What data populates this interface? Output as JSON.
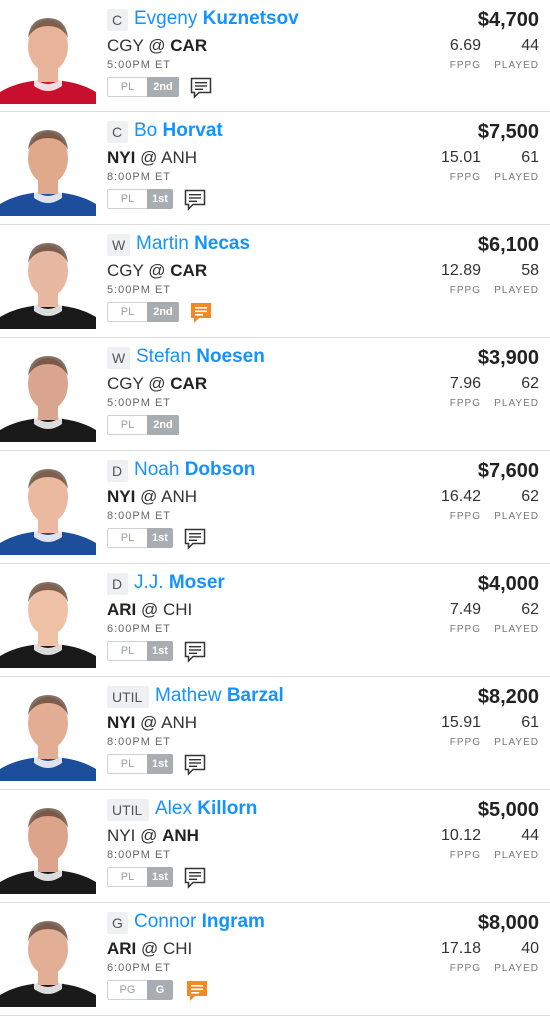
{
  "colors": {
    "accent": "#1493ff",
    "note_active": "#f08a24"
  },
  "labels": {
    "fppg": "FPPG",
    "played": "PLAYED",
    "pl": "PL"
  },
  "players": [
    {
      "pos": "C",
      "first": "Evgeny",
      "last": "Kuznetsov",
      "away": "CGY",
      "home": "CAR",
      "bold": "home",
      "time": "5:00PM ET",
      "badge_left": "PL",
      "badge_right": "2nd",
      "note": "note-icon",
      "salary": "$4,700",
      "fppg": "6.69",
      "played": "44",
      "jersey": "#c8102e",
      "skin": "#e7b39a"
    },
    {
      "pos": "C",
      "first": "Bo",
      "last": "Horvat",
      "away": "NYI",
      "home": "ANH",
      "bold": "away",
      "time": "8:00PM ET",
      "badge_left": "PL",
      "badge_right": "1st",
      "note": "note-icon",
      "salary": "$7,500",
      "fppg": "15.01",
      "played": "61",
      "jersey": "#1c4e9c",
      "skin": "#e0a98c"
    },
    {
      "pos": "W",
      "first": "Martin",
      "last": "Necas",
      "away": "CGY",
      "home": "CAR",
      "bold": "home",
      "time": "5:00PM ET",
      "badge_left": "PL",
      "badge_right": "2nd",
      "note": "note-icon-active",
      "salary": "$6,100",
      "fppg": "12.89",
      "played": "58",
      "jersey": "#1a1a1a",
      "skin": "#e8b9a2"
    },
    {
      "pos": "W",
      "first": "Stefan",
      "last": "Noesen",
      "away": "CGY",
      "home": "CAR",
      "bold": "home",
      "time": "5:00PM ET",
      "badge_left": "PL",
      "badge_right": "2nd",
      "note": "",
      "salary": "$3,900",
      "fppg": "7.96",
      "played": "62",
      "jersey": "#1a1a1a",
      "skin": "#d9a58f"
    },
    {
      "pos": "D",
      "first": "Noah",
      "last": "Dobson",
      "away": "NYI",
      "home": "ANH",
      "bold": "away",
      "time": "8:00PM ET",
      "badge_left": "PL",
      "badge_right": "1st",
      "note": "note-icon",
      "salary": "$7,600",
      "fppg": "16.42",
      "played": "62",
      "jersey": "#1c4e9c",
      "skin": "#eab9a0"
    },
    {
      "pos": "D",
      "first": "J.J.",
      "last": "Moser",
      "away": "ARI",
      "home": "CHI",
      "bold": "away",
      "time": "6:00PM ET",
      "badge_left": "PL",
      "badge_right": "1st",
      "note": "note-icon",
      "salary": "$4,000",
      "fppg": "7.49",
      "played": "62",
      "jersey": "#1a1a1a",
      "skin": "#efc2a8"
    },
    {
      "pos": "UTIL",
      "first": "Mathew",
      "last": "Barzal",
      "away": "NYI",
      "home": "ANH",
      "bold": "away",
      "time": "8:00PM ET",
      "badge_left": "PL",
      "badge_right": "1st",
      "note": "note-icon",
      "salary": "$8,200",
      "fppg": "15.91",
      "played": "61",
      "jersey": "#1c4e9c",
      "skin": "#e2ad92"
    },
    {
      "pos": "UTIL",
      "first": "Alex",
      "last": "Killorn",
      "away": "NYI",
      "home": "ANH",
      "bold": "home",
      "time": "8:00PM ET",
      "badge_left": "PL",
      "badge_right": "1st",
      "note": "note-icon",
      "salary": "$5,000",
      "fppg": "10.12",
      "played": "44",
      "jersey": "#1a1a1a",
      "skin": "#dca48a"
    },
    {
      "pos": "G",
      "first": "Connor",
      "last": "Ingram",
      "away": "ARI",
      "home": "CHI",
      "bold": "away",
      "time": "6:00PM ET",
      "badge_left": "PG",
      "badge_right": "G",
      "note": "note-icon-active",
      "salary": "$8,000",
      "fppg": "17.18",
      "played": "40",
      "jersey": "#1a1a1a",
      "skin": "#e2ae96"
    }
  ]
}
